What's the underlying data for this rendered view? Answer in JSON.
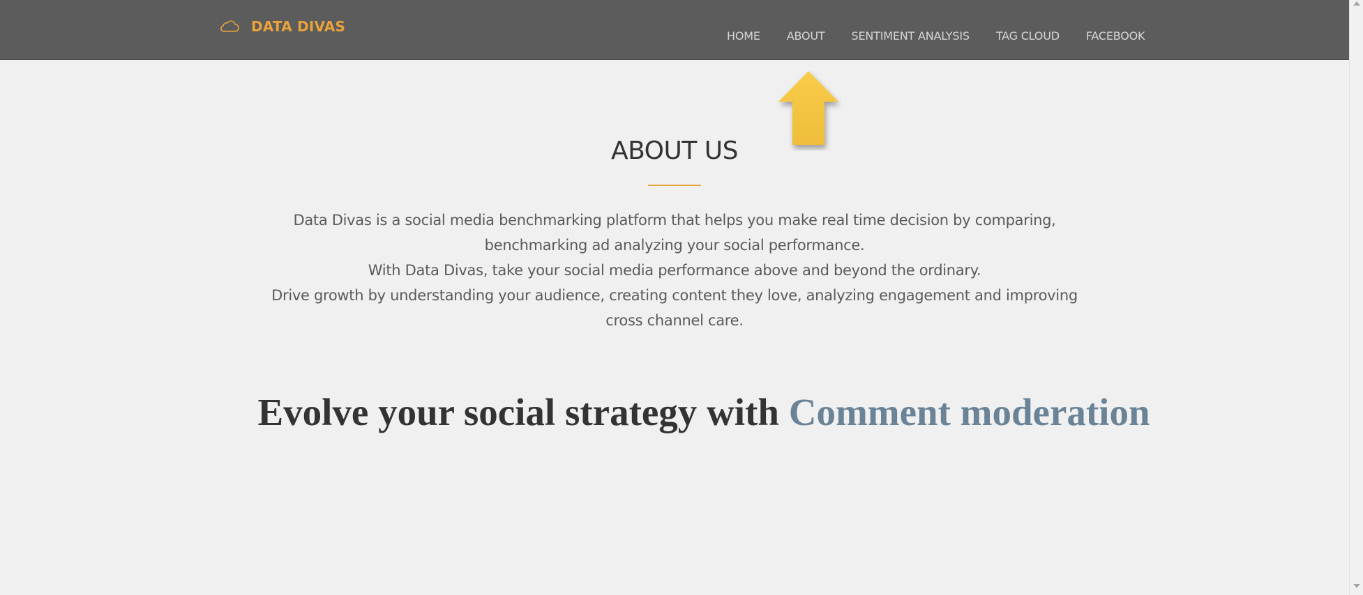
{
  "brand": {
    "name": "DATA DIVAS",
    "icon": "cloud-icon",
    "color": "#e8a33a"
  },
  "nav": {
    "items": [
      {
        "label": "HOME"
      },
      {
        "label": "ABOUT"
      },
      {
        "label": "SENTIMENT ANALYSIS"
      },
      {
        "label": "TAG CLOUD"
      },
      {
        "label": "FACEBOOK"
      }
    ],
    "background": "#5c5c5c"
  },
  "annotation": {
    "icon": "up-arrow-icon",
    "color": "#f6c443"
  },
  "about": {
    "title": "ABOUT US",
    "paragraphs": [
      "Data Divas is a social media benchmarking platform that helps you make real time decision by comparing, benchmarking ad analyzing your social performance.",
      "With Data Divas, take your social media performance above and beyond the ordinary.",
      "Drive growth by understanding your audience, creating content they love, analyzing engagement and improving cross channel care."
    ]
  },
  "tagline": {
    "prefix": "Evolve your social strategy with",
    "highlight": "Comment moderation",
    "highlight_color": "#6b8396"
  }
}
